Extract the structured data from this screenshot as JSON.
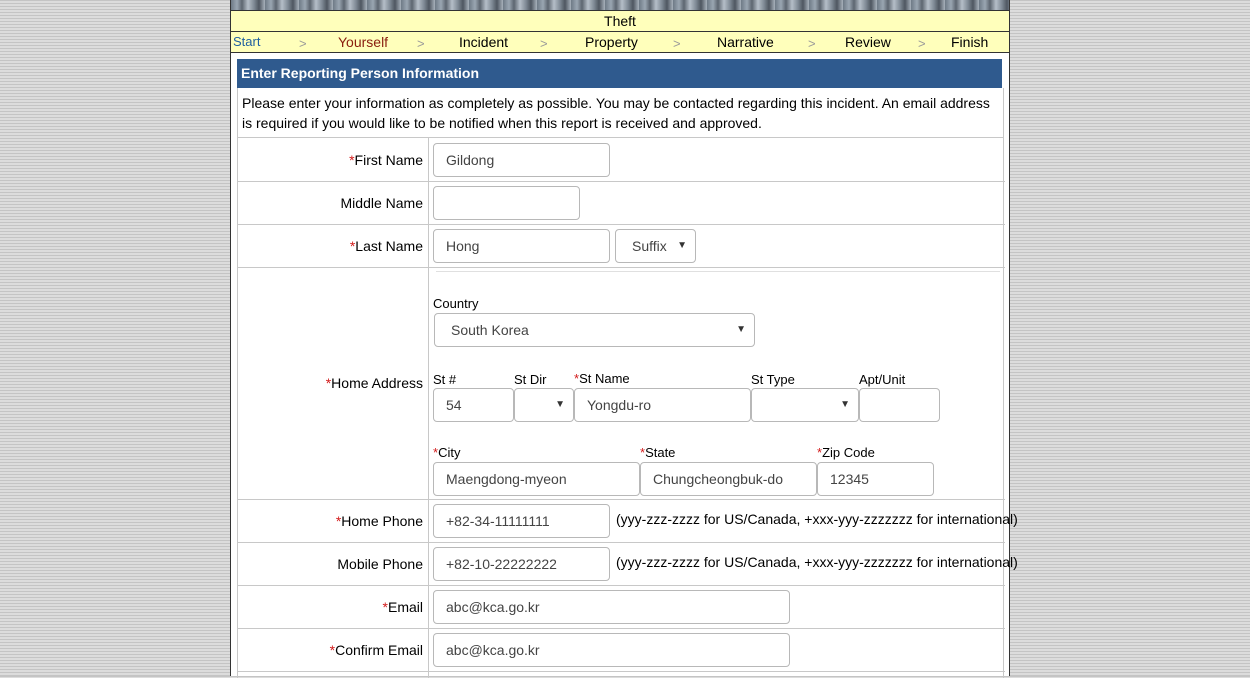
{
  "header": {
    "title": "Theft"
  },
  "steps": {
    "start": "Start",
    "yourself": "Yourself",
    "incident": "Incident",
    "property": "Property",
    "narrative": "Narrative",
    "review": "Review",
    "finish": "Finish",
    "separator": ">"
  },
  "section": {
    "title": "Enter Reporting Person Information",
    "intro": "Please enter your information as completely as possible. You may be contacted regarding this incident. An email address is required if you would like to be notified when this report is received and approved."
  },
  "required_marker": "*",
  "form": {
    "first_name": {
      "label": "First Name",
      "value": "Gildong"
    },
    "middle_name": {
      "label": "Middle Name",
      "value": ""
    },
    "last_name": {
      "label": "Last Name",
      "value": "Hong"
    },
    "suffix": {
      "value": "Suffix"
    },
    "home_address": {
      "label": "Home Address",
      "country_label": "Country",
      "country_value": "South Korea",
      "st_num_label": "St #",
      "st_num_value": "54",
      "st_dir_label": "St Dir",
      "st_dir_value": "",
      "st_name_label": "St Name",
      "st_name_value": "Yongdu-ro",
      "st_type_label": "St Type",
      "st_type_value": "",
      "apt_label": "Apt/Unit",
      "apt_value": "",
      "city_label": "City",
      "city_value": "Maengdong-myeon",
      "state_label": "State",
      "state_value": "Chungcheongbuk-do",
      "zip_label": "Zip Code",
      "zip_value": "12345"
    },
    "home_phone": {
      "label": "Home Phone",
      "value": "+82-34-11111111"
    },
    "mobile_phone": {
      "label": "Mobile Phone",
      "value": "+82-10-22222222"
    },
    "phone_hint": "(yyy-zzz-zzzz for US/Canada, +xxx-yyy-zzzzzzz for international)",
    "email": {
      "label": "Email",
      "value": "abc@kca.go.kr"
    },
    "confirm_email": {
      "label": "Confirm Email",
      "value": "abc@kca.go.kr"
    }
  },
  "icons": {
    "dropdown": "caret-down-icon",
    "step_separator": "chevron-right-icon"
  },
  "colors": {
    "section_header": "#2f5a8e",
    "step_bar": "#ffffbb",
    "required": "#d21a1a",
    "current_step": "#8b2010"
  }
}
